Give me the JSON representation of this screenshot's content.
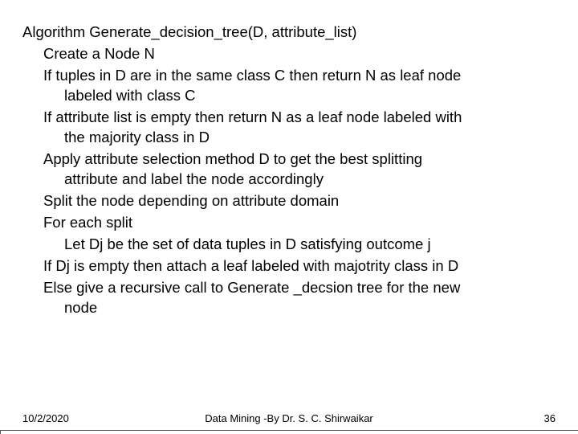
{
  "content": {
    "title": "Algorithm Generate_decision_tree(D, attribute_list)",
    "lines": [
      "Create a Node N",
      "If tuples in D are in the same class C then return N as leaf node labeled with class C",
      "If attribute list is empty then return N as a leaf node labeled with the majority class in D",
      "Apply attribute selection method D to get the best splitting attribute and label the node accordingly",
      "Split the node depending on attribute domain",
      "For each split",
      "Let Dj be the set of data tuples in D satisfying outcome j",
      "If Dj is empty then attach a leaf labeled with majotrity class in D",
      "Else give a recursive call to Generate _decsion tree for the new node"
    ]
  },
  "footer": {
    "date": "10/2/2020",
    "center": "Data Mining -By Dr. S. C. Shirwaikar",
    "page": "36"
  }
}
